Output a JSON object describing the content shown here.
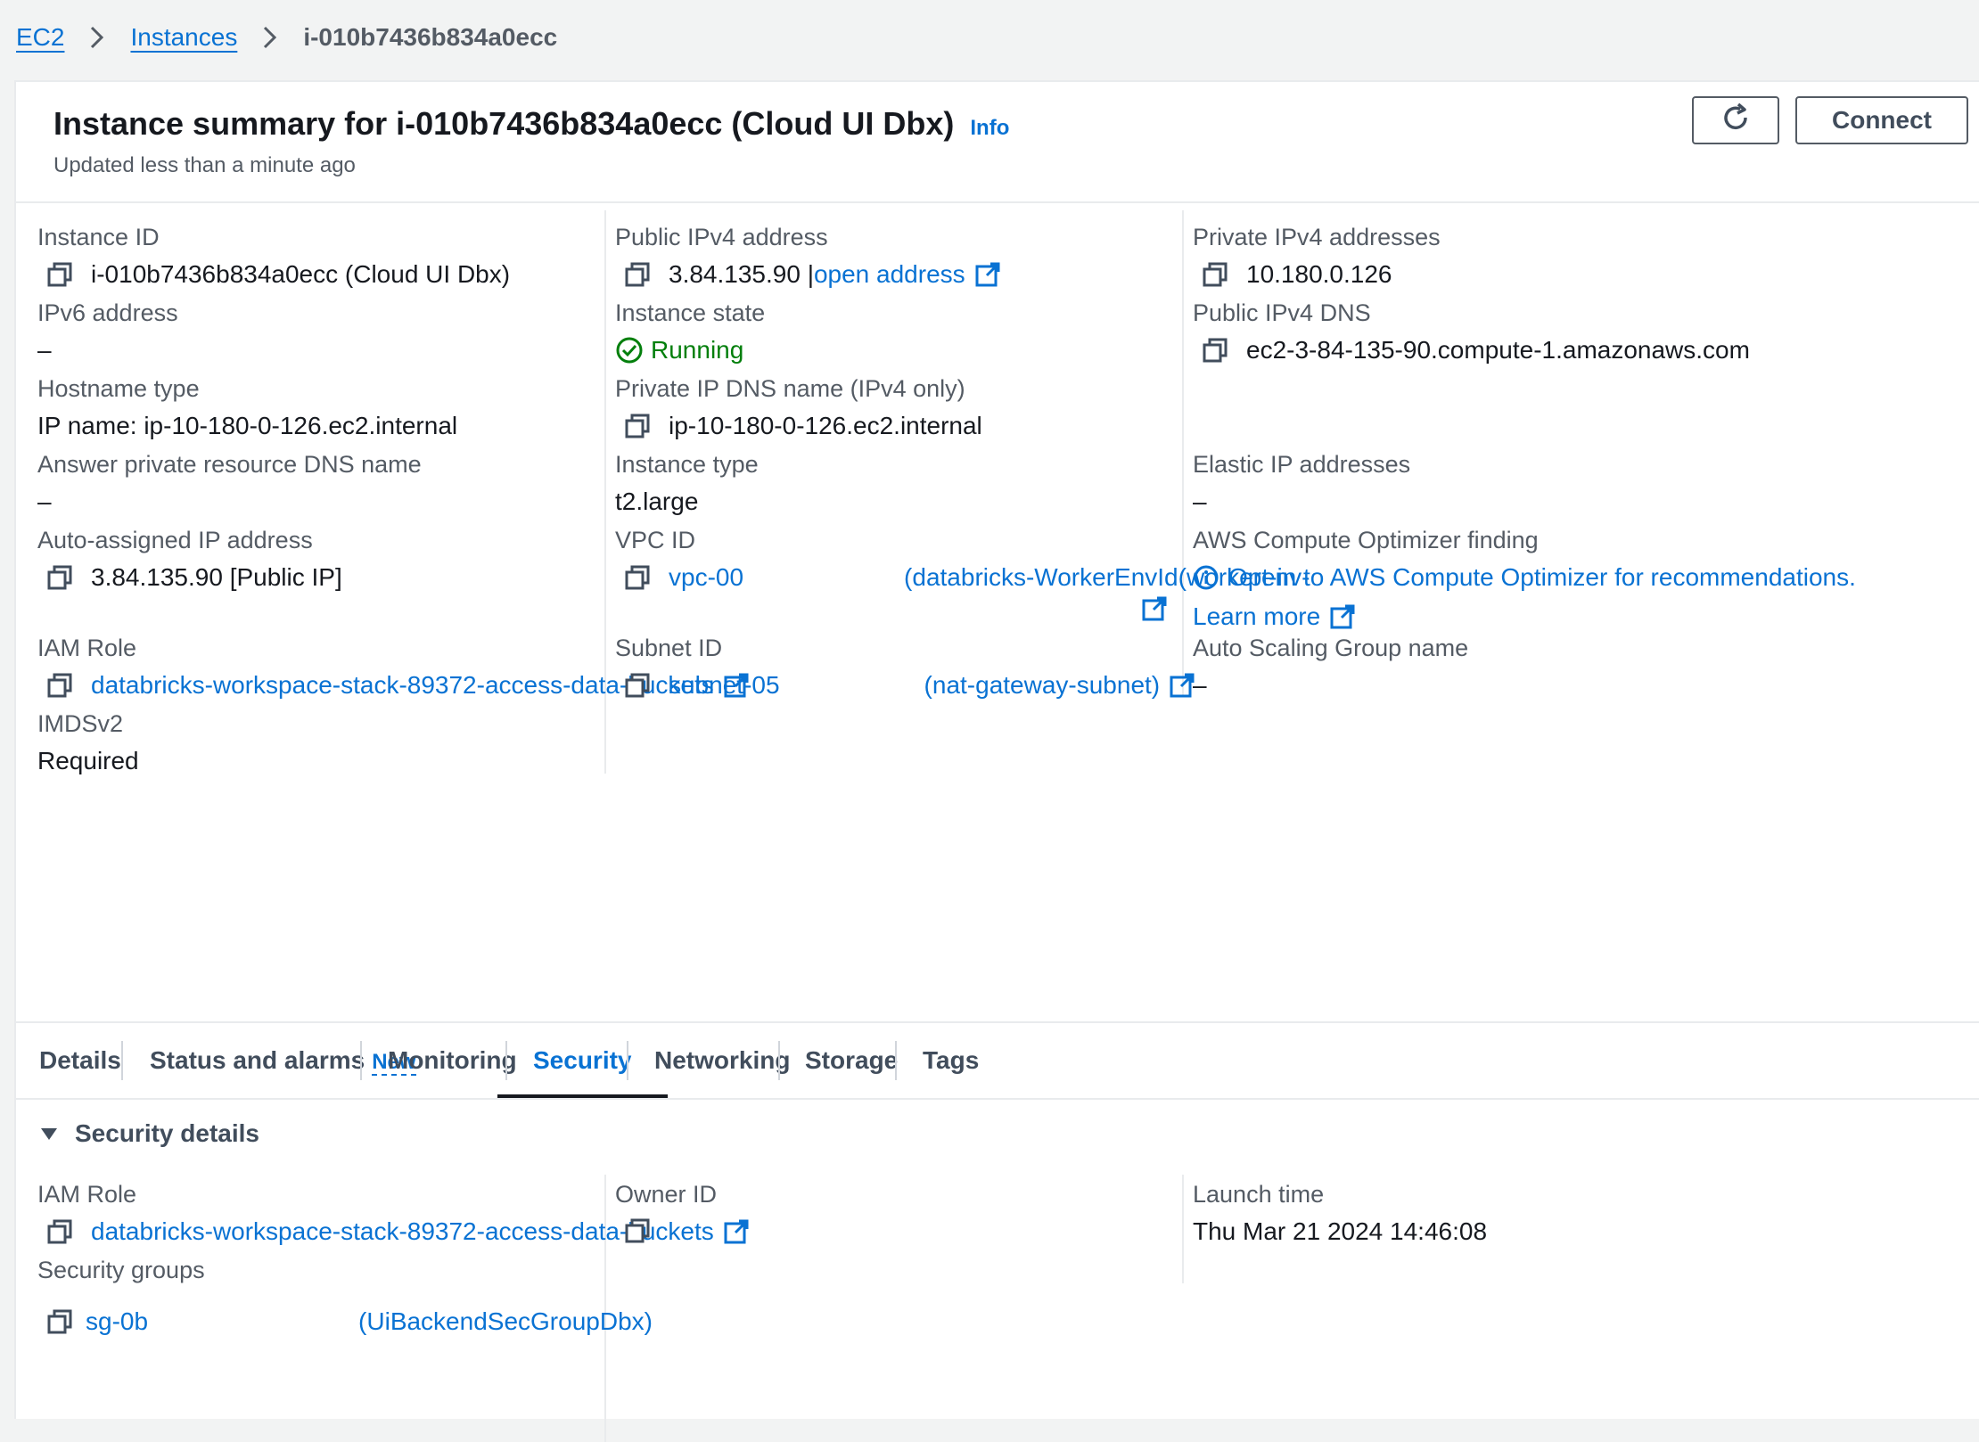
{
  "breadcrumb": {
    "ec2": "EC2",
    "instances": "Instances",
    "current": "i-010b7436b834a0ecc"
  },
  "header": {
    "title": "Instance summary for i-010b7436b834a0ecc (Cloud UI Dbx)",
    "info": "Info",
    "updated": "Updated less than a minute ago",
    "connect": "Connect"
  },
  "summary": {
    "instance_id": {
      "label": "Instance ID",
      "value": "i-010b7436b834a0ecc (Cloud UI Dbx)"
    },
    "ipv6": {
      "label": "IPv6 address",
      "value": "–"
    },
    "hostname_type": {
      "label": "Hostname type",
      "value": "IP name: ip-10-180-0-126.ec2.internal"
    },
    "answer_dns": {
      "label": "Answer private resource DNS name",
      "value": "–"
    },
    "auto_ip": {
      "label": "Auto-assigned IP address",
      "value": "3.84.135.90 [Public IP]"
    },
    "iam_role": {
      "label": "IAM Role",
      "value": "databricks-workspace-stack-89372-access-data-buckets"
    },
    "imds": {
      "label": "IMDSv2",
      "value": "Required"
    },
    "public_ipv4": {
      "label": "Public IPv4 address",
      "value": "3.84.135.90 |",
      "link": "open address"
    },
    "state": {
      "label": "Instance state",
      "value": "Running"
    },
    "private_dns": {
      "label": "Private IP DNS name (IPv4 only)",
      "value": "ip-10-180-0-126.ec2.internal"
    },
    "instance_type": {
      "label": "Instance type",
      "value": "t2.large"
    },
    "vpc": {
      "label": "VPC ID",
      "value": "vpc-00",
      "name": "(databricks-WorkerEnvId(workerenv-"
    },
    "subnet": {
      "label": "Subnet ID",
      "value": "subnet-05",
      "name": "(nat-gateway-subnet)"
    },
    "private_ipv4": {
      "label": "Private IPv4 addresses",
      "value": "10.180.0.126"
    },
    "public_dns": {
      "label": "Public IPv4 DNS",
      "value": "ec2-3-84-135-90.compute-1.amazonaws.com"
    },
    "elastic_ip": {
      "label": "Elastic IP addresses",
      "value": "–"
    },
    "optimizer": {
      "label": "AWS Compute Optimizer finding",
      "link": "Opt-in to AWS Compute Optimizer for recommendations.",
      "learn": "Learn more"
    },
    "asg": {
      "label": "Auto Scaling Group name",
      "value": "–"
    }
  },
  "tabs": {
    "details": "Details",
    "status": "Status and alarms",
    "status_badge": "New",
    "monitoring": "Monitoring",
    "security": "Security",
    "networking": "Networking",
    "storage": "Storage",
    "tags": "Tags",
    "active": "Security"
  },
  "security": {
    "heading": "Security details",
    "iam_role": {
      "label": "IAM Role",
      "value": "databricks-workspace-stack-89372-access-data-buckets"
    },
    "owner": {
      "label": "Owner ID",
      "value": ""
    },
    "launch": {
      "label": "Launch time",
      "value": "Thu Mar 21 2024 14:46:08"
    },
    "groups": {
      "label": "Security groups",
      "value": "sg-0b",
      "name": "(UiBackendSecGroupDbx)"
    }
  },
  "colors": {
    "link": "#0972d3",
    "running": "#037f0c",
    "text": "#16191f",
    "label": "#545b64"
  }
}
